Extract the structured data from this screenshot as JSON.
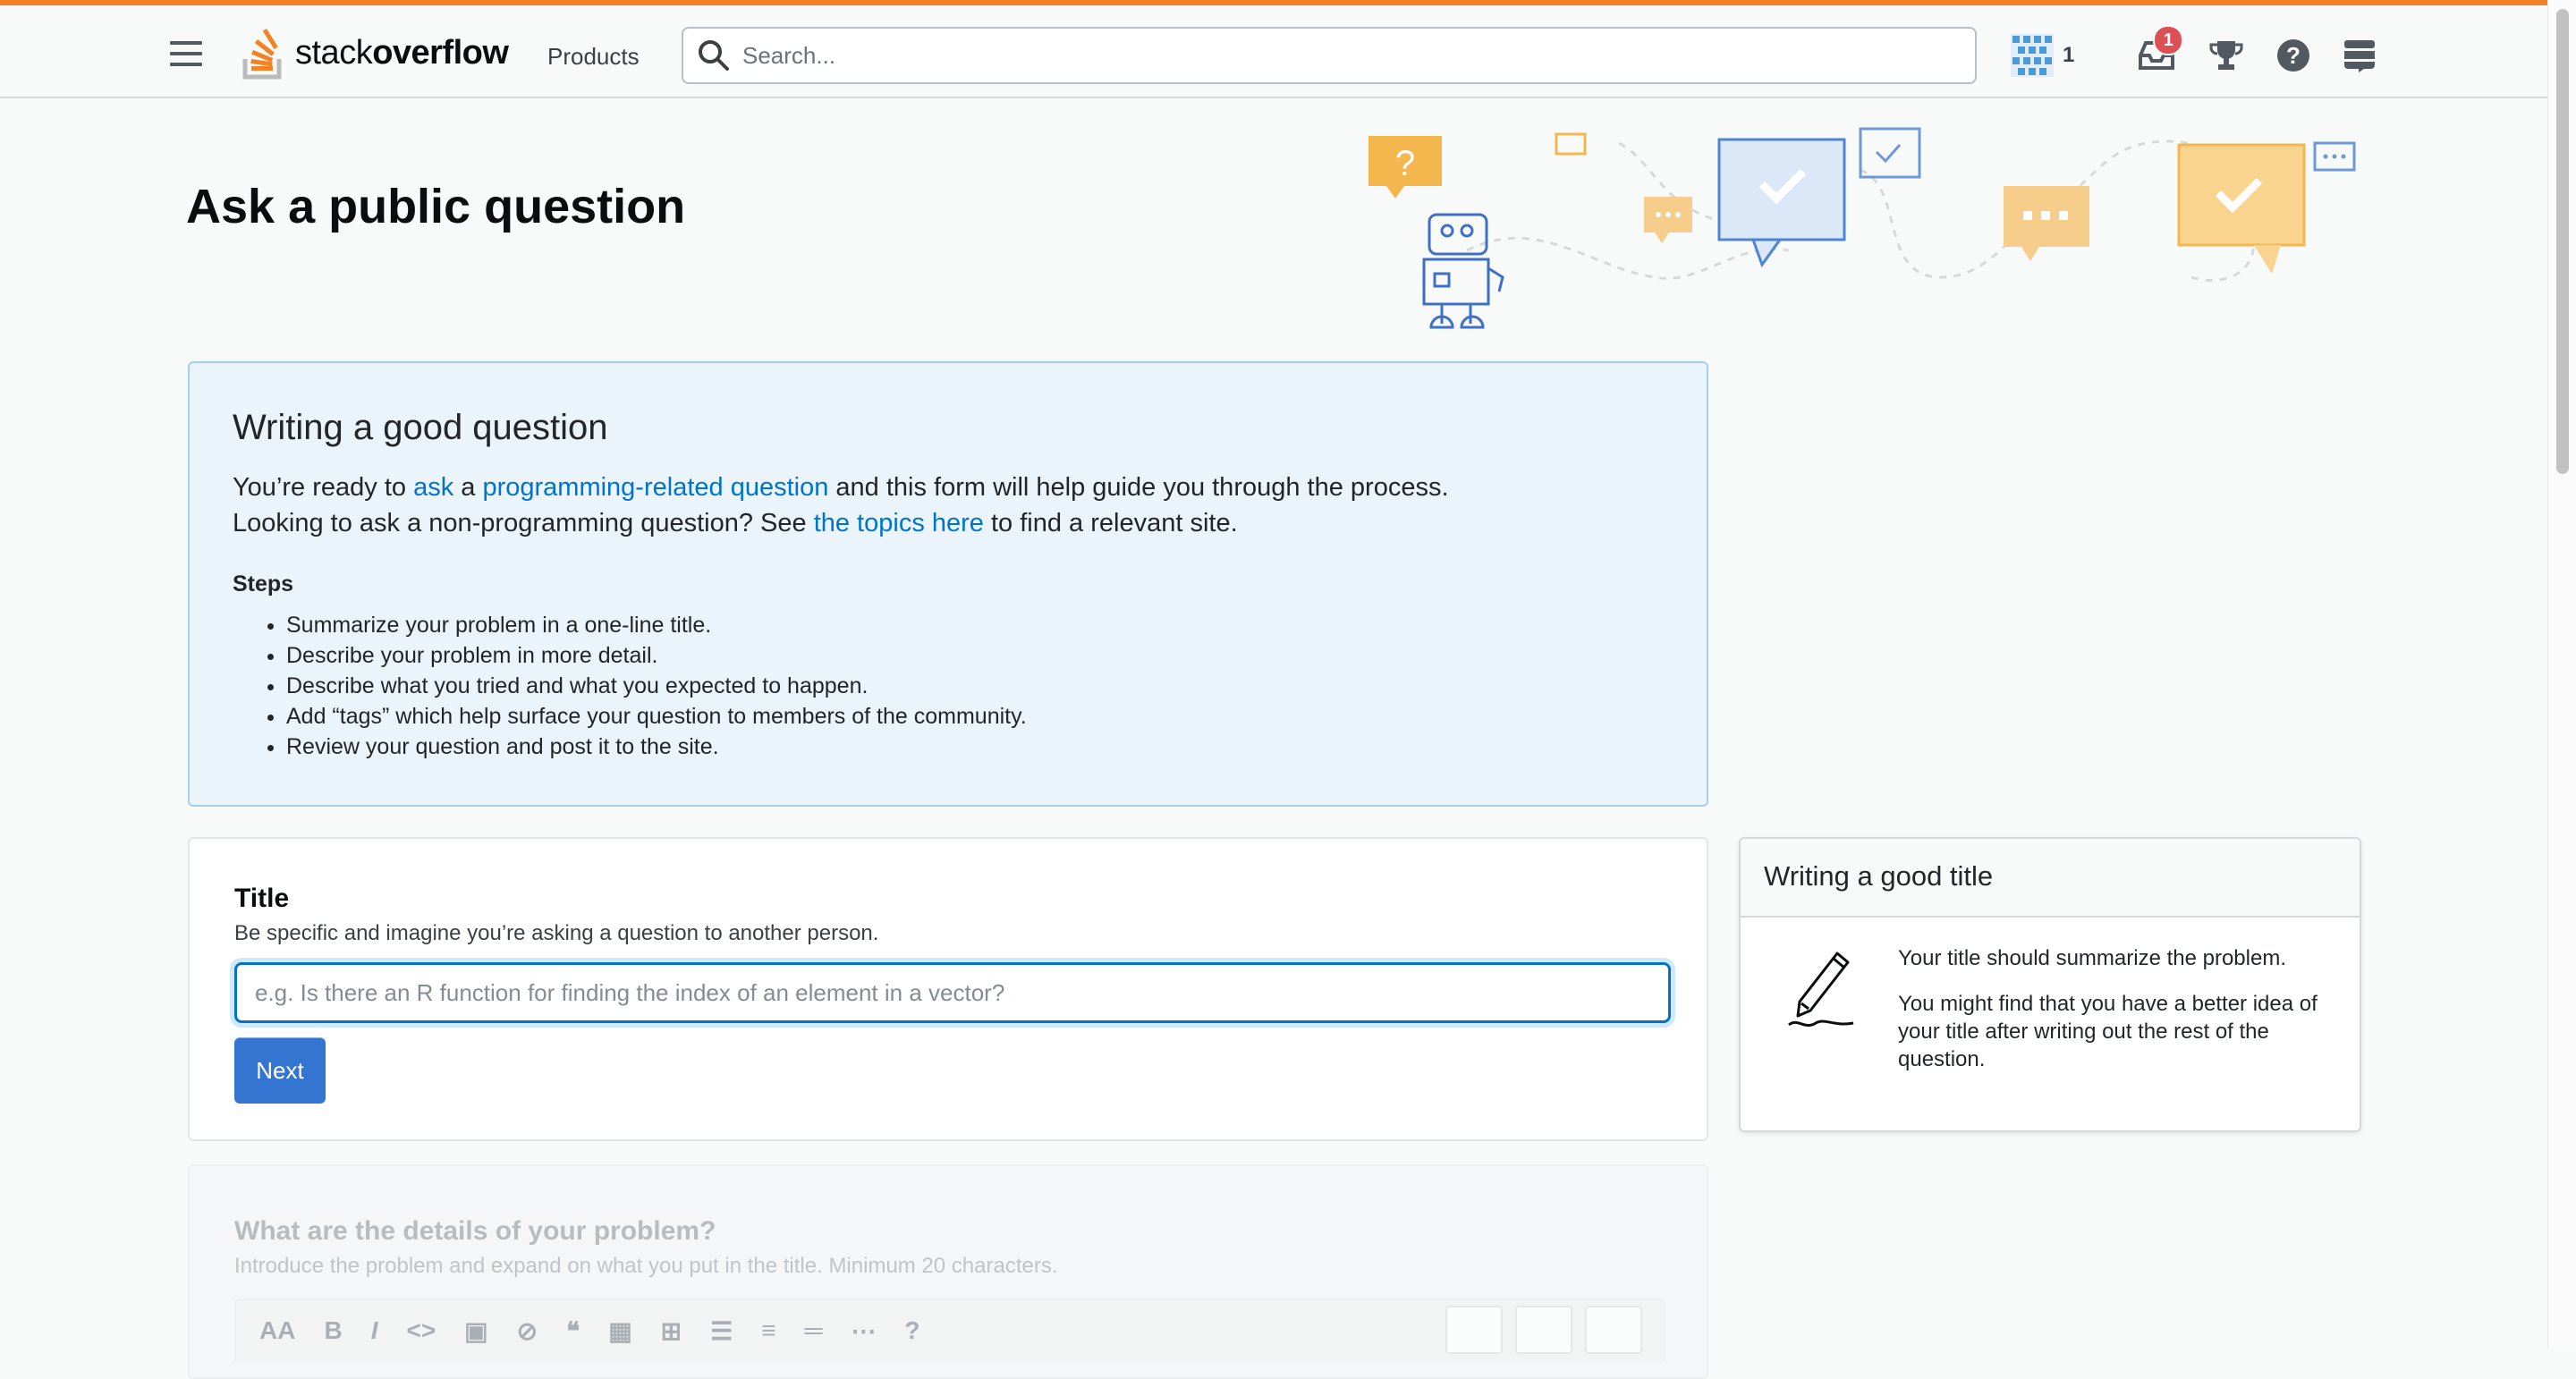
{
  "topbar": {
    "logo_text_light": "stack",
    "logo_text_bold": "overflow",
    "products_label": "Products",
    "search_placeholder": "Search...",
    "reputation": "1",
    "inbox_badge": "1",
    "accent_color": "#f48225"
  },
  "page": {
    "title": "Ask a public question"
  },
  "info_box": {
    "heading": "Writing a good question",
    "line1_pre": "You’re ready to ",
    "link_ask": "ask",
    "line1_mid": " a ",
    "link_programming": "programming-related question",
    "line1_post": " and this form will help guide you through the process.",
    "line2_pre": "Looking to ask a non-programming question? See ",
    "link_topics": "the topics here",
    "line2_post": " to find a relevant site.",
    "steps_heading": "Steps",
    "steps": [
      "Summarize your problem in a one-line title.",
      "Describe your problem in more detail.",
      "Describe what you tried and what you expected to happen.",
      "Add “tags” which help surface your question to members of the community.",
      "Review your question and post it to the site."
    ]
  },
  "title_card": {
    "label": "Title",
    "description": "Be specific and imagine you’re asking a question to another person.",
    "placeholder": "e.g. Is there an R function for finding the index of an element in a vector?",
    "next_label": "Next"
  },
  "help_card": {
    "heading": "Writing a good title",
    "p1": "Your title should summarize the problem.",
    "p2": "You might find that you have a better idea of your title after writing out the rest of the question."
  },
  "details_card": {
    "label": "What are the details of your problem?",
    "description": "Introduce the problem and expand on what you put in the title. Minimum 20 characters."
  }
}
